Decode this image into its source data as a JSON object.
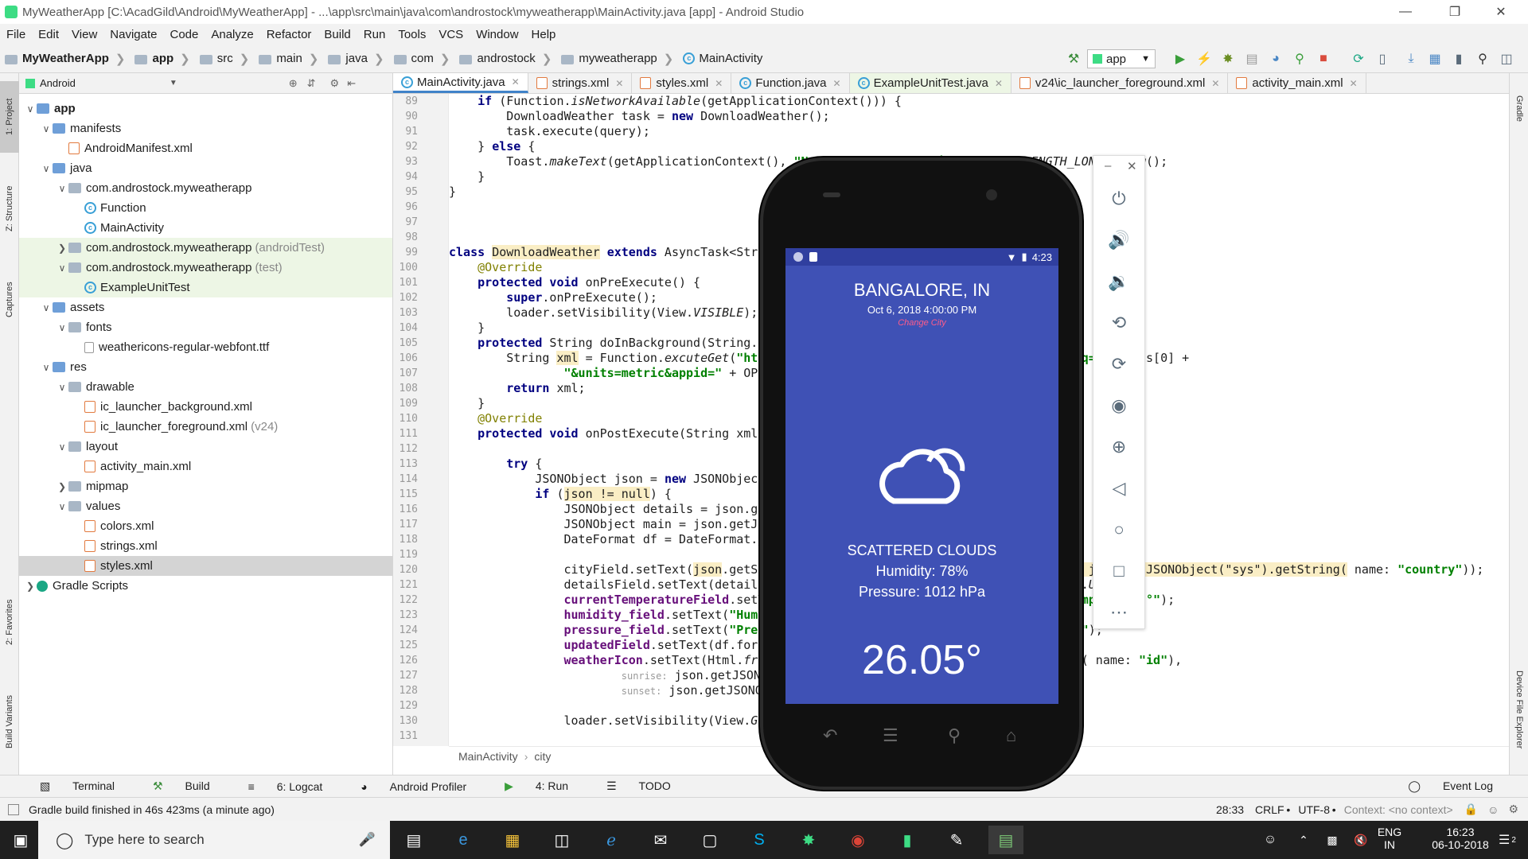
{
  "window": {
    "title": "MyWeatherApp [C:\\AcadGild\\Android\\MyWeatherApp] - ...\\app\\src\\main\\java\\com\\androstock\\myweatherapp\\MainActivity.java [app] - Android Studio"
  },
  "menu": [
    "File",
    "Edit",
    "View",
    "Navigate",
    "Code",
    "Analyze",
    "Refactor",
    "Build",
    "Run",
    "Tools",
    "VCS",
    "Window",
    "Help"
  ],
  "nav": {
    "project": "MyWeatherApp",
    "module": "app",
    "src": "src",
    "main": "main",
    "java": "java",
    "com": "com",
    "androstock": "androstock",
    "pkg": "myweatherapp",
    "cls": "MainActivity",
    "run_config": "app"
  },
  "left_tabs": {
    "project": "1: Project",
    "structure": "Z: Structure",
    "captures": "Captures",
    "favorites": "2: Favorites",
    "build_variants": "Build Variants"
  },
  "right_tabs": {
    "gradle": "Gradle",
    "device_explorer": "Device File Explorer"
  },
  "project_panel": {
    "view": "Android",
    "rows": [
      {
        "label": "app",
        "extra": ""
      },
      {
        "label": "manifests",
        "extra": ""
      },
      {
        "label": "AndroidManifest.xml",
        "extra": ""
      },
      {
        "label": "java",
        "extra": ""
      },
      {
        "label": "com.androstock.myweatherapp",
        "extra": ""
      },
      {
        "label": "Function",
        "extra": ""
      },
      {
        "label": "MainActivity",
        "extra": ""
      },
      {
        "label": "com.androstock.myweatherapp",
        "extra": "(androidTest)"
      },
      {
        "label": "com.androstock.myweatherapp",
        "extra": "(test)"
      },
      {
        "label": "ExampleUnitTest",
        "extra": ""
      },
      {
        "label": "assets",
        "extra": ""
      },
      {
        "label": "fonts",
        "extra": ""
      },
      {
        "label": "weathericons-regular-webfont.ttf",
        "extra": ""
      },
      {
        "label": "res",
        "extra": ""
      },
      {
        "label": "drawable",
        "extra": ""
      },
      {
        "label": "ic_launcher_background.xml",
        "extra": ""
      },
      {
        "label": "ic_launcher_foreground.xml",
        "extra": "(v24)"
      },
      {
        "label": "layout",
        "extra": ""
      },
      {
        "label": "activity_main.xml",
        "extra": ""
      },
      {
        "label": "mipmap",
        "extra": ""
      },
      {
        "label": "values",
        "extra": ""
      },
      {
        "label": "colors.xml",
        "extra": ""
      },
      {
        "label": "strings.xml",
        "extra": ""
      },
      {
        "label": "styles.xml",
        "extra": ""
      },
      {
        "label": "Gradle Scripts",
        "extra": ""
      }
    ]
  },
  "editor_tabs": [
    "MainActivity.java",
    "strings.xml",
    "styles.xml",
    "Function.java",
    "ExampleUnitTest.java",
    "v24\\ic_launcher_foreground.xml",
    "activity_main.xml"
  ],
  "line_numbers": [
    "89",
    "90",
    "91",
    "92",
    "93",
    "94",
    "95",
    "96",
    "97",
    "98",
    "99",
    "100",
    "101",
    "102",
    "103",
    "104",
    "105",
    "106",
    "107",
    "108",
    "109",
    "110",
    "111",
    "112",
    "113",
    "114",
    "115",
    "116",
    "117",
    "118",
    "119",
    "120",
    "121",
    "122",
    "123",
    "124",
    "125",
    "126",
    "127",
    "128",
    "129",
    "130",
    "131"
  ],
  "editor_breadcrumb": {
    "cls": "MainActivity",
    "member": "city"
  },
  "bottom_tools": [
    "Terminal",
    "Build",
    "6: Logcat",
    "Android Profiler",
    "4: Run",
    "TODO",
    "Event Log"
  ],
  "status": {
    "message": "Gradle build finished in 46s 423ms (a minute ago)",
    "position": "28:33",
    "line_sep": "CRLF",
    "encoding": "UTF-8",
    "context": "Context: <no context>"
  },
  "emulator": {
    "time": "4:23",
    "city": "BANGALORE, IN",
    "date": "Oct 6, 2018 4:00:00 PM",
    "change": "Change City",
    "desc": "SCATTERED CLOUDS",
    "humidity": "Humidity: 78%",
    "pressure": "Pressure: 1012 hPa",
    "temp": "26.05°"
  },
  "taskbar": {
    "search": "Type here to search",
    "lang1": "ENG",
    "lang2": "IN",
    "time": "16:23",
    "date": "06-10-2018",
    "notif": "2"
  }
}
